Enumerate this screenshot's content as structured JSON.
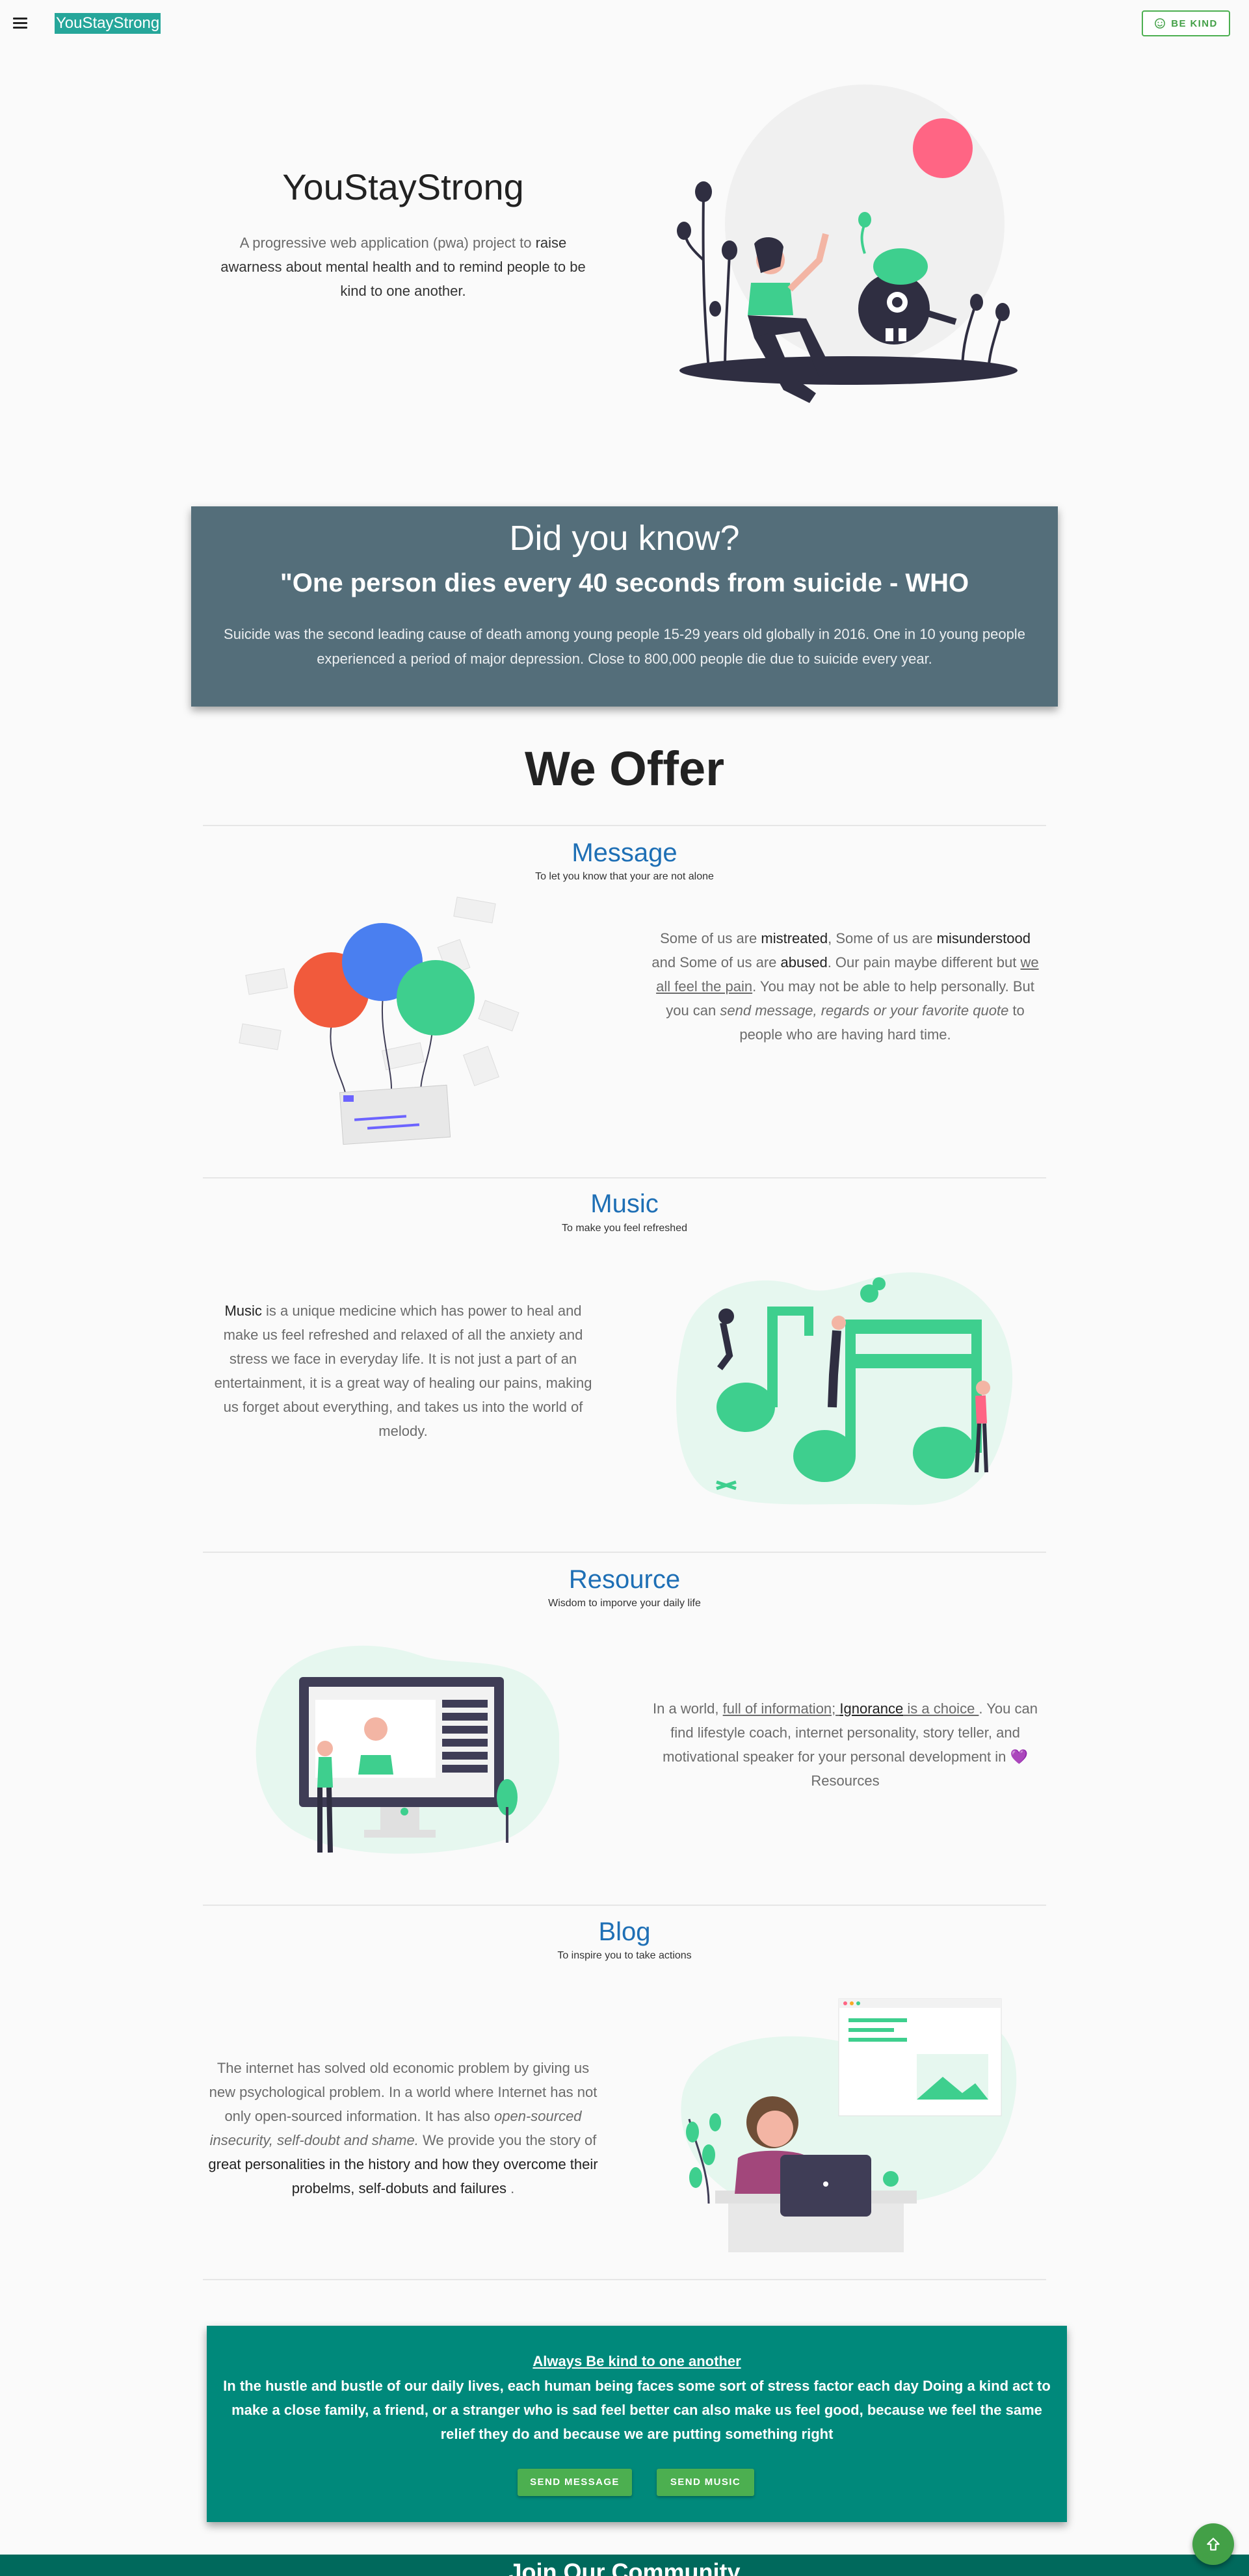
{
  "header": {
    "brand": "YouStayStrong",
    "be_kind_label": "BE KIND",
    "icons": {
      "menu": "menu-icon",
      "be_kind": "smile-icon"
    }
  },
  "hero": {
    "title": "YouStayStrong",
    "text_parts": [
      "A progressive web application (pwa) project to ",
      "raise awarness about mental health and to remind people to be kind to one another."
    ]
  },
  "did_you_know": {
    "title": "Did you know?",
    "quote": "\"One person dies every 40 seconds from suicide - WHO",
    "body": "Suicide was the second leading cause of death among young people 15-29 years old globally in 2016. One in 10 young people experienced a period of major depression. Close to 800,000 people die due to suicide every year."
  },
  "offer": {
    "title": "We Offer",
    "sections": [
      {
        "title": "Message",
        "subtitle": "To let you know that your are not alone",
        "text": [
          "Some of us are ",
          "mistreated",
          ", Some of us are ",
          "misunderstood",
          " and Some of us are ",
          "abused",
          ". Our pain maybe different but ",
          "we all feel the pain",
          ". You may not be able to help personally. But you can ",
          "send message, regards or your favorite quote",
          " to people who are having hard time."
        ]
      },
      {
        "title": "Music",
        "subtitle": "To make you feel refreshed",
        "text": [
          "Music",
          " is a unique medicine which has power to heal and make us feel refreshed and relaxed of all the anxiety and stress we face in everyday life. It is not just a part of an entertainment, it is a great way of healing our pains, making us forget about everything, and takes us into the world of melody."
        ]
      },
      {
        "title": "Resource",
        "subtitle": "Wisdom to imporve your daily life",
        "text": [
          "In a world, ",
          "full of information; ",
          "Ignorance",
          " is a choice ",
          ". You can find lifestyle coach, internet personality, story teller, and motivational speaker for your personal development in ",
          "💜",
          "Resources"
        ]
      },
      {
        "title": "Blog",
        "subtitle": "To inspire you to take actions",
        "text": [
          "The internet has solved old economic problem by giving us new psychological problem. In a world where Internet has not only open-sourced information. It has also ",
          "open-sourced insecurity, self-doubt and shame.",
          " We provide you the story of ",
          "great personalities in the history and how they overcome their probelms, self-dobuts and failures",
          " ."
        ]
      }
    ]
  },
  "banner": {
    "title": "Always Be kind to one another",
    "body": "In the hustle and bustle of our daily lives, each human being faces some sort of stress factor each day Doing a kind act to make a close family, a friend, or a stranger who is sad feel better can also make us feel good, because we feel the same relief they do and because we are putting something right",
    "send_message_label": "SEND MESSAGE",
    "send_music_label": "SEND MUSIC"
  },
  "footer": {
    "title": "Join Our Community"
  },
  "fab": {
    "icon": "arrow-up-icon"
  },
  "colors": {
    "brand": "#26a69a",
    "accent_green": "#3ecf8e",
    "section_title": "#1e6fb5",
    "did_you_know_bg": "#546e7a",
    "banner_bg": "#00897b",
    "button_green": "#4caf50"
  }
}
